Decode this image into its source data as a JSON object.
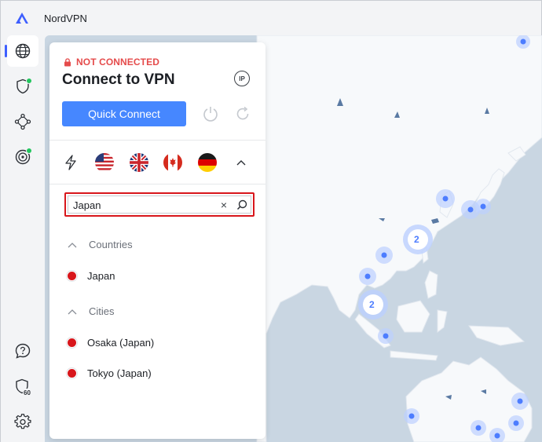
{
  "window": {
    "title": "NordVPN"
  },
  "sidebar": {
    "items": [
      {
        "name": "globe",
        "active": true
      },
      {
        "name": "shield",
        "badge": true
      },
      {
        "name": "meshnet"
      },
      {
        "name": "target",
        "badge": true
      }
    ],
    "bottom": [
      {
        "name": "help"
      },
      {
        "name": "dark-web-monitor",
        "label": "60"
      },
      {
        "name": "settings"
      }
    ]
  },
  "panel": {
    "status": "NOT CONNECTED",
    "title": "Connect to VPN",
    "ip_label": "IP",
    "quick_connect_label": "Quick Connect",
    "flags": [
      "lightning",
      "united-states",
      "united-kingdom",
      "canada",
      "germany"
    ],
    "search": {
      "value": "Japan",
      "clear_label": "×"
    },
    "sections": [
      {
        "header": "Countries",
        "items": [
          "Japan"
        ]
      },
      {
        "header": "Cities",
        "items": [
          "Osaka (Japan)",
          "Tokyo (Japan)"
        ]
      }
    ]
  },
  "map": {
    "clusters": [
      {
        "label": "2"
      },
      {
        "label": "2"
      }
    ]
  },
  "colors": {
    "accent": "#4687ff",
    "status_red": "#e54b4b",
    "search_border": "#d8161b",
    "map_sea": "#c9d6e2",
    "map_land": "#f7f9fb",
    "server_dot": "#4d7dff"
  }
}
